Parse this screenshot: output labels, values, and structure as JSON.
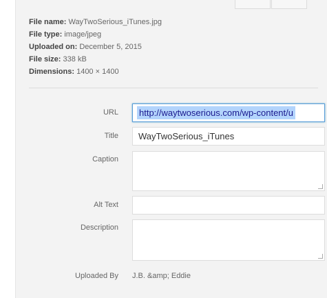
{
  "details": {
    "file_name_label": "File name:",
    "file_name": "WayTwoSerious_iTunes.jpg",
    "file_type_label": "File type:",
    "file_type": "image/jpeg",
    "uploaded_on_label": "Uploaded on:",
    "uploaded_on": "December 5, 2015",
    "file_size_label": "File size:",
    "file_size": "338 kB",
    "dimensions_label": "Dimensions:",
    "dimensions": "1400 × 1400"
  },
  "form": {
    "url_label": "URL",
    "url_value": "http://waytwoserious.com/wp-content/u",
    "title_label": "Title",
    "title_value": "WayTwoSerious_iTunes",
    "caption_label": "Caption",
    "alt_label": "Alt Text",
    "description_label": "Description",
    "uploaded_by_label": "Uploaded By",
    "uploaded_by_value": "J.B. &amp; Eddie"
  }
}
